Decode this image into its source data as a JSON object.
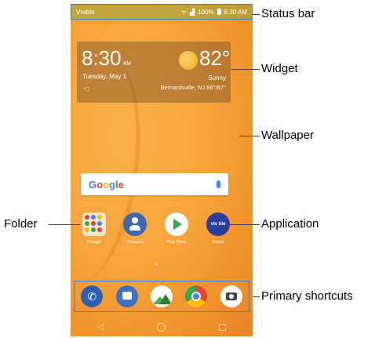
{
  "status_bar": {
    "carrier": "Visible",
    "battery": "100%",
    "time": "8:30 AM"
  },
  "widget": {
    "time": "8:30",
    "ampm": "AM",
    "date": "Tuesday, May 1",
    "temperature": "82°",
    "condition": "Sunny",
    "location": "Bernardsville, NJ 86°/67°"
  },
  "search": {
    "logo_letters": [
      "G",
      "o",
      "o",
      "g",
      "l",
      "e"
    ]
  },
  "apps": [
    {
      "label": "Google"
    },
    {
      "label": "Contacts"
    },
    {
      "label": "Play Store"
    },
    {
      "label": "Visible",
      "icon_text": "vis ble"
    }
  ],
  "dock": [
    "phone-icon",
    "messages-icon",
    "gallery-icon",
    "chrome-icon",
    "camera-icon"
  ],
  "callouts": {
    "status_bar": "Status bar",
    "widget": "Widget",
    "wallpaper": "Wallpaper",
    "folder": "Folder",
    "application": "Application",
    "primary_shortcuts": "Primary shortcuts"
  }
}
